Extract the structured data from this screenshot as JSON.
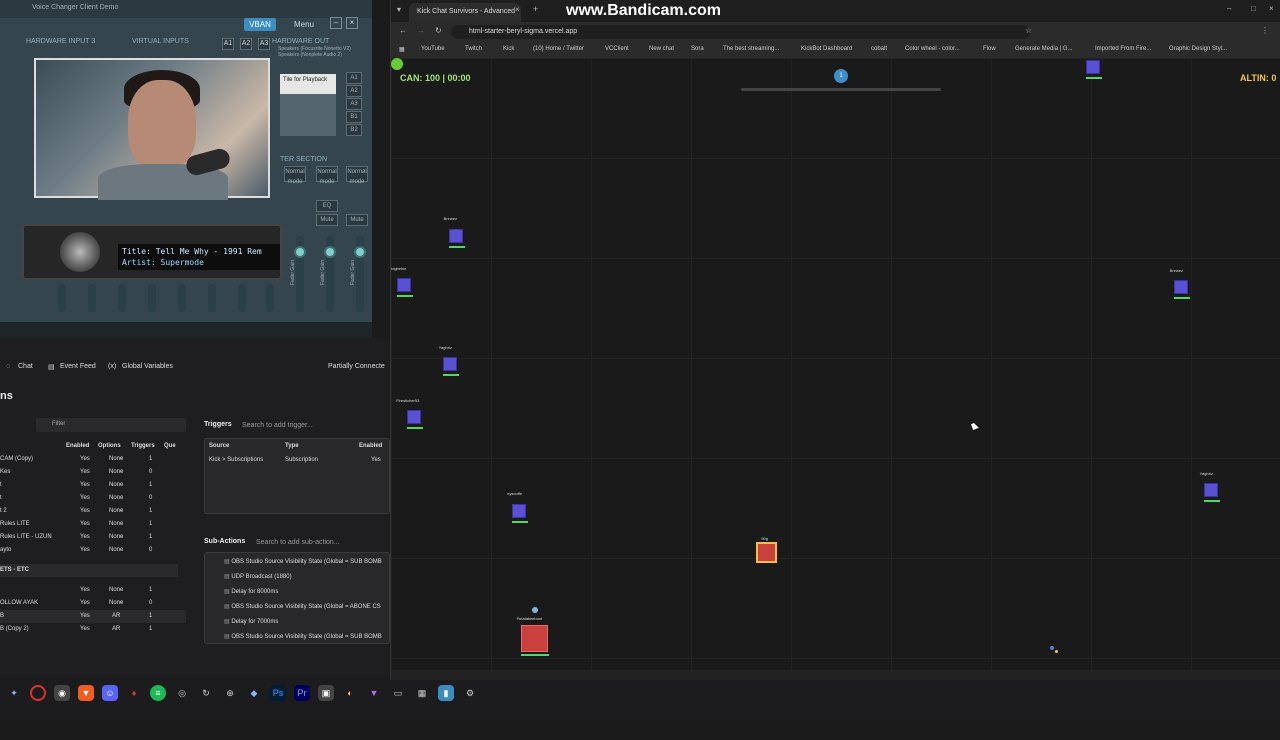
{
  "voicemeeter": {
    "title": "Voice Changer Client Demo",
    "vban_label": "VBAN",
    "menu_label": "Menu",
    "hardware_input_label": "HARDWARE INPUT 3",
    "virtual_inputs_label": "VIRTUAL INPUTS",
    "hardware_out_label": "HARDWARE OUT",
    "out_buttons": [
      "A1",
      "A2",
      "A3"
    ],
    "bus_buttons": [
      "A1",
      "A2",
      "A3",
      "B1",
      "B2"
    ],
    "device_line1": "Speakers (Focusrite Nonetto V2)",
    "device_line2": "Speakers (Nonplete Audio 2)",
    "playback_label": "Tile for Playback",
    "master_section_label": "TER SECTION",
    "mode_label": "Normal mode",
    "fader_label": "Fader Gain",
    "mute_label": "Mute",
    "eq_label": "EQ"
  },
  "radio": {
    "title": "Title: Tell Me Why - 1991 Rem",
    "artist": "Artist: Supermode"
  },
  "streamerbot": {
    "tabs": [
      "Chat",
      "Event Feed",
      "Global Variables"
    ],
    "connection_status": "Partially Connecte",
    "section_title": "ns",
    "filter_placeholder": "Filter",
    "columns": [
      "Enabled",
      "Options",
      "Triggers",
      "Que"
    ],
    "rows": [
      {
        "name": "CAM (Copy)",
        "enabled": "Yes",
        "options": "None",
        "triggers": "1"
      },
      {
        "name": "Kes",
        "enabled": "Yes",
        "options": "None",
        "triggers": "0"
      },
      {
        "name": "t",
        "enabled": "Yes",
        "options": "None",
        "triggers": "1"
      },
      {
        "name": "t",
        "enabled": "Yes",
        "options": "None",
        "triggers": "0"
      },
      {
        "name": "t 2",
        "enabled": "Yes",
        "options": "None",
        "triggers": "1"
      },
      {
        "name": "Rules LITE",
        "enabled": "Yes",
        "options": "None",
        "triggers": "1"
      },
      {
        "name": "Rules LITE - UZUN",
        "enabled": "Yes",
        "options": "None",
        "triggers": "1"
      },
      {
        "name": "ayto",
        "enabled": "Yes",
        "options": "None",
        "triggers": "0"
      }
    ],
    "group_label": "ETS - ETC",
    "group_rows": [
      {
        "name": "",
        "enabled": "Yes",
        "options": "None",
        "triggers": "1"
      },
      {
        "name": "OLLOW AYAK",
        "enabled": "Yes",
        "options": "None",
        "triggers": "0"
      },
      {
        "name": "B",
        "enabled": "Yes",
        "options": "AR",
        "triggers": "1"
      },
      {
        "name": "B (Copy 2)",
        "enabled": "Yes",
        "options": "AR",
        "triggers": "1"
      }
    ],
    "triggers_label": "Triggers",
    "triggers_search": "Search to add trigger...",
    "trigger_columns": [
      "Source",
      "Type",
      "Enabled"
    ],
    "trigger_row": {
      "source": "Kick > Subscriptions",
      "type": "Subscription",
      "enabled": "Yes"
    },
    "subactions_label": "Sub-Actions",
    "subactions_search": "Search to add sub-action...",
    "subactions": [
      "OBS Studio Source Visibility State (Global = SUB BOMB",
      "UDP Broadcast (1880)",
      "Delay for 8000ms",
      "OBS Studio Source Visibility State (Global = ABONE CS",
      "Delay for 7000ms",
      "OBS Studio Source Visibility State (Global = SUB BOMB"
    ]
  },
  "browser": {
    "tab_title": "Kick Chat Survivors - Advanced",
    "url": "html-starter-beryl-sigma.vercel.app",
    "watermark": "www.Bandicam.com",
    "bookmarks": [
      "YouTube",
      "Twitch",
      "Kick",
      "(10) Home / Twitter",
      "VCClient",
      "New chat",
      "Sora",
      "The best streaming...",
      "KickBot Dashboard",
      "cobalt",
      "Color wheel - color...",
      "Flow",
      "Generate Media | G...",
      "Imported From Fire...",
      "Graphic Design Styl..."
    ]
  },
  "game": {
    "hud_left": "CAN: 100 | 00:00",
    "hud_right": "ALTIN: 0",
    "progress_dot_label": "1",
    "players": [
      {
        "name": "Brewez"
      },
      {
        "name": "bigbehin"
      },
      {
        "name": "Yaghriz"
      },
      {
        "name": "Firesticher53"
      },
      {
        "name": "Brewez"
      },
      {
        "name": "Yaghriz"
      },
      {
        "name": "eyscoffe"
      }
    ],
    "box_label": "50g",
    "enemy_label": "Futatakeeboot"
  },
  "colors": {
    "player": "#5b4fd3",
    "health": "#4cd964",
    "box": "#c9403d",
    "gold": "#f5c542",
    "hud_green": "#9fe870"
  }
}
